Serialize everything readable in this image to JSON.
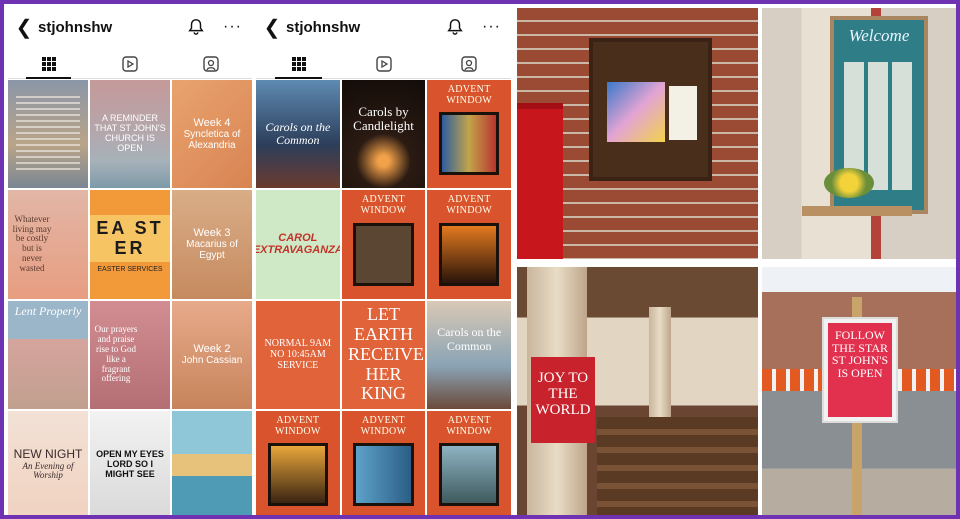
{
  "profiles": [
    {
      "username": "stjohnshw"
    },
    {
      "username": "stjohnshw"
    }
  ],
  "icons": {
    "back": "chevron-left-icon",
    "bell": "bell-icon",
    "more": "more-icon",
    "grid": "grid-icon",
    "reels": "reels-icon",
    "tagged": "tagged-icon"
  },
  "grid1": {
    "t1": "",
    "t2": "A REMINDER THAT ST JOHN'S CHURCH IS OPEN",
    "t3_week": "Week 4",
    "t3_name": "Syncletica of Alexandria",
    "t4": "Whatever living may be costly but is never wasted",
    "t5": "EA ST ER",
    "t5_sub": "EASTER SERVICES",
    "t6_week": "Week 3",
    "t6_name": "Macarius of Egypt",
    "t7": "Lent Properly",
    "t8": "Our prayers and praise rise to God like a fragrant offering",
    "t9_week": "Week 2",
    "t9_name": "John Cassian",
    "t10": "NEW NIGHT",
    "t10_sub": "An Evening of Worship",
    "t11": "OPEN MY EYES LORD SO I MIGHT SEE",
    "t12": ""
  },
  "grid2": {
    "t1": "Carols on the Common",
    "t2": "Carols by Candlelight",
    "t3": "ADVENT WINDOW",
    "t4": "CAROL EXTRAVAGANZA",
    "t5": "ADVENT WINDOW",
    "t6": "ADVENT WINDOW",
    "t7": "NORMAL 9AM NO 10:45AM SERVICE",
    "t8": "LET EARTH RECEIVE HER KING",
    "t9": "Carols on the Common",
    "t10": "ADVENT WINDOW",
    "t11": "ADVENT WINDOW",
    "t12": "ADVENT WINDOW"
  },
  "photos": {
    "welcome": "Welcome",
    "joy": "JOY TO THE WORLD",
    "follow": "FOLLOW THE STAR ST JOHN'S IS OPEN"
  },
  "colors": {
    "border": "#6f32b2",
    "advent": "#d9542c"
  }
}
